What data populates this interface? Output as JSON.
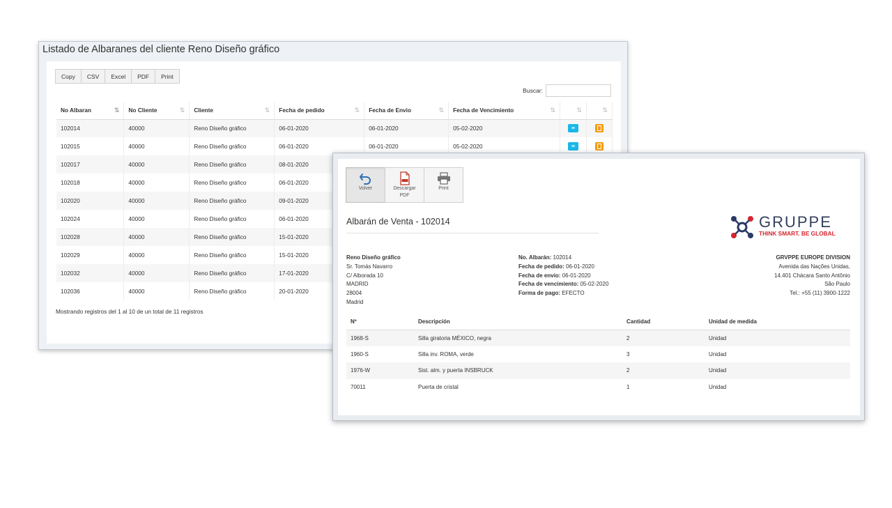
{
  "list_window": {
    "title": "Listado de Albaranes del cliente Reno Diseño gráfico",
    "export_buttons": [
      "Copy",
      "CSV",
      "Excel",
      "PDF",
      "Print"
    ],
    "search_label": "Buscar:",
    "columns": [
      "No Albaran",
      "No Cliente",
      "Cliente",
      "Fecha de pedido",
      "Fecha de Envio",
      "Fecha de Vencimiento"
    ],
    "rows": [
      [
        "102014",
        "40000",
        "Reno Diseño gráfico",
        "06-01-2020",
        "06-01-2020",
        "05-02-2020"
      ],
      [
        "102015",
        "40000",
        "Reno Diseño gráfico",
        "06-01-2020",
        "06-01-2020",
        "05-02-2020"
      ],
      [
        "102017",
        "40000",
        "Reno Diseño gráfico",
        "08-01-2020",
        "",
        ""
      ],
      [
        "102018",
        "40000",
        "Reno Diseño gráfico",
        "06-01-2020",
        "",
        ""
      ],
      [
        "102020",
        "40000",
        "Reno Diseño gráfico",
        "09-01-2020",
        "",
        ""
      ],
      [
        "102024",
        "40000",
        "Reno Diseño gráfico",
        "06-01-2020",
        "",
        ""
      ],
      [
        "102028",
        "40000",
        "Reno Diseño gráfico",
        "15-01-2020",
        "",
        ""
      ],
      [
        "102029",
        "40000",
        "Reno Diseño gráfico",
        "15-01-2020",
        "",
        ""
      ],
      [
        "102032",
        "40000",
        "Reno Diseño gráfico",
        "17-01-2020",
        "",
        ""
      ],
      [
        "102036",
        "40000",
        "Reno Diseño gráfico",
        "20-01-2020",
        "",
        ""
      ]
    ],
    "footer": "Mostrando registros del 1 al 10 de un total de 11 registros",
    "colors": {
      "view_button": "#1ab7e8",
      "doc_button": "#f39c12"
    }
  },
  "detail_window": {
    "toolbar": {
      "back_label": "Volver",
      "pdf_label_1": "Descargar",
      "pdf_label_2": "PDF",
      "print_label": "Print"
    },
    "title": "Albarán de Venta - 102014",
    "logo": {
      "wordmark": "GRUPPE",
      "tagline": "THINK SMART. BE GLOBAL"
    },
    "client": {
      "name": "Reno Diseño gráfico",
      "lines": [
        "Sr. Tomás Navarro",
        "C/ Alborada 10",
        "MADRID",
        "28004",
        "Madrid"
      ]
    },
    "meta": [
      {
        "label": "No. Albarán:",
        "value": "102014"
      },
      {
        "label": "Fecha de pedido:",
        "value": "06-01-2020"
      },
      {
        "label": "Fecha de envio:",
        "value": "06-01-2020"
      },
      {
        "label": "Fecha de vencimiento:",
        "value": "05-02-2020"
      },
      {
        "label": "Forma de pago:",
        "value": "EFECTO"
      }
    ],
    "company": {
      "name": "GRVPPE EUROPE DIVISION",
      "lines": [
        "Avenida das Nações Unidas,",
        "14.401 Chácara Santo Antônio",
        "São Paulo",
        "Tel.: +55 (11) 3900-1222"
      ]
    },
    "items_columns": [
      "Nº",
      "Descripción",
      "Cantidad",
      "Unidad de medida"
    ],
    "items": [
      [
        "1968-S",
        "Silla giratoria MÉXICO, negra",
        "2",
        "Unidad"
      ],
      [
        "1960-S",
        "Silla inv. ROMA, verde",
        "3",
        "Unidad"
      ],
      [
        "1976-W",
        "Sist. alm. y puerta INSBRUCK",
        "2",
        "Unidad"
      ],
      [
        "70011",
        "Puerta de cristal",
        "1",
        "Unidad"
      ]
    ]
  }
}
